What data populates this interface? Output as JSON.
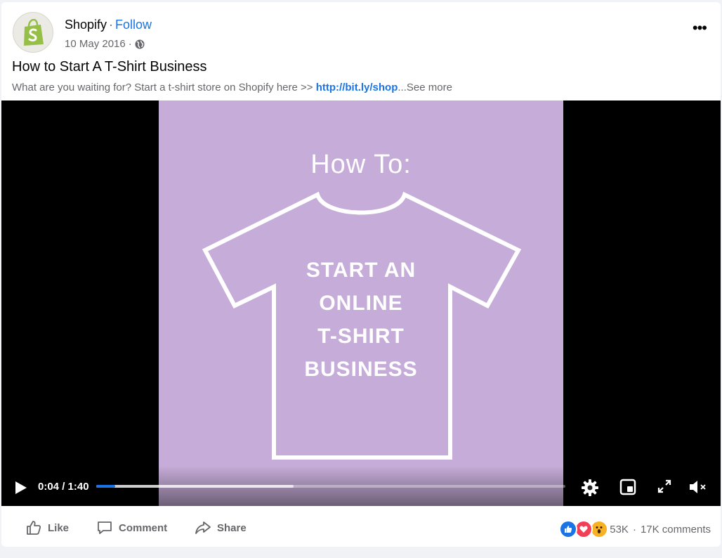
{
  "post": {
    "page_name": "Shopify",
    "separator": "·",
    "follow_label": "Follow",
    "date": "10 May 2016",
    "date_separator": "·",
    "more_label": "•••",
    "title": "How to Start A T-Shirt Business",
    "description_text": "What are you waiting for? Start a t-shirt store on Shopify here >> ",
    "description_link": "http://bit.ly/shop",
    "description_ellipsis": "...",
    "see_more": "See more"
  },
  "video": {
    "heading": "How To:",
    "shirt_lines": [
      "START AN",
      "ONLINE",
      "T-SHIRT",
      "BUSINESS"
    ],
    "background_color": "#c6acd8",
    "current_time": "0:04",
    "duration": "1:40",
    "time_display": "0:04 / 1:40",
    "progress_fraction": 0.04,
    "buffered_fraction": 0.42,
    "icons": [
      "play-icon",
      "settings-icon",
      "miniplayer-icon",
      "fullscreen-icon",
      "mute-icon"
    ]
  },
  "footer": {
    "like_label": "Like",
    "comment_label": "Comment",
    "share_label": "Share",
    "reaction_count": "53K",
    "separator": "·",
    "comment_count": "17K comments",
    "reaction_icons": [
      "like-reaction-icon",
      "love-reaction-icon",
      "wow-reaction-icon"
    ]
  },
  "colors": {
    "accent": "#1b74e4",
    "shopify_green": "#95bf47",
    "love": "#f33e58",
    "wow": "#f7b125"
  }
}
